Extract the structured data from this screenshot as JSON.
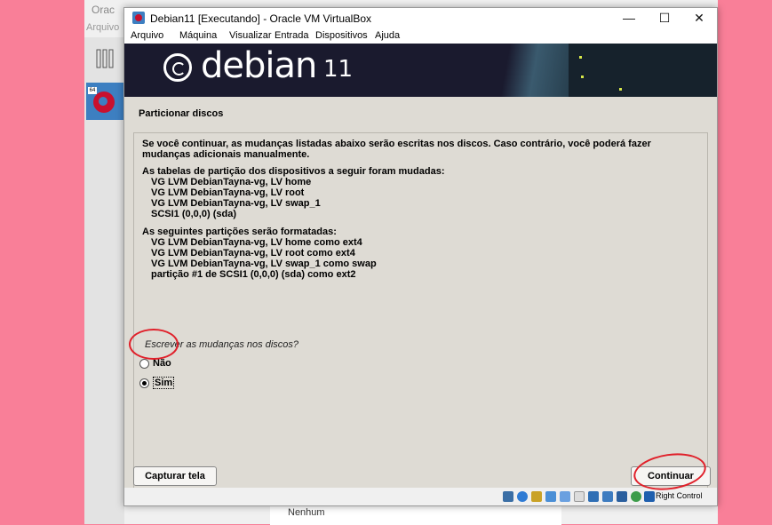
{
  "manager": {
    "title_fragment": "Orac",
    "menu_fragment": "Arquivo",
    "list_empty_label": "Nenhum"
  },
  "window": {
    "title": "Debian11 [Executando] - Oracle VM VirtualBox",
    "minimize": "—",
    "maximize": "☐",
    "close": "✕"
  },
  "menubar": [
    "Arquivo",
    "Máquina",
    "Visualizar",
    "Entrada",
    "Dispositivos",
    "Ajuda"
  ],
  "banner": {
    "logo_text": "debian",
    "version": "11"
  },
  "installer": {
    "section_title": "Particionar discos",
    "intro": "Se você continuar, as mudanças listadas abaixo serão escritas nos discos. Caso contrário, você poderá fazer mudanças adicionais manualmente.",
    "changed_heading": "As tabelas de partição dos dispositivos a seguir foram mudadas:",
    "changed_items": [
      "VG LVM DebianTayna-vg, LV home",
      "VG LVM DebianTayna-vg, LV root",
      "VG LVM DebianTayna-vg, LV swap_1",
      "SCSI1 (0,0,0) (sda)"
    ],
    "format_heading": "As seguintes partições serão formatadas:",
    "format_items": [
      "VG LVM DebianTayna-vg, LV home como ext4",
      "VG LVM DebianTayna-vg, LV root como ext4",
      "VG LVM DebianTayna-vg, LV swap_1 como swap",
      "partição #1 de SCSI1 (0,0,0) (sda) como ext2"
    ],
    "question": "Escrever as mudanças nos discos?",
    "options": [
      {
        "label": "Não",
        "selected": false
      },
      {
        "label": "Sim",
        "selected": true
      }
    ],
    "screenshot_button": "Capturar tela",
    "continue_button": "Continuar"
  },
  "statusbar": {
    "host_key": "Right Control"
  },
  "colors": {
    "annotation": "#e0202a",
    "desktop": "#f97f98",
    "banner": "#1a1a2e"
  }
}
